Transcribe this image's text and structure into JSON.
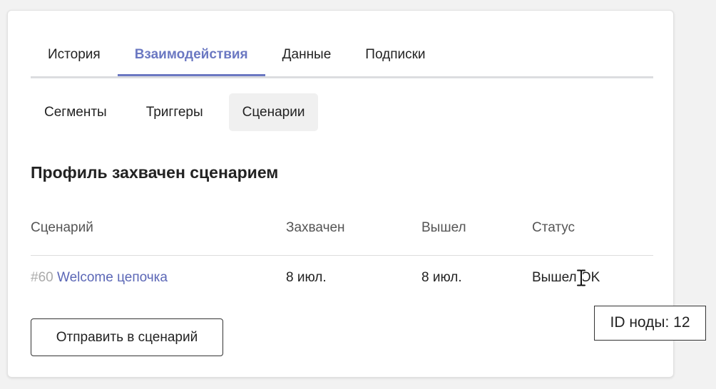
{
  "tabs": [
    {
      "label": "История",
      "active": false
    },
    {
      "label": "Взаимодействия",
      "active": true
    },
    {
      "label": "Данные",
      "active": false
    },
    {
      "label": "Подписки",
      "active": false
    }
  ],
  "subtabs": [
    {
      "label": "Сегменты",
      "active": false
    },
    {
      "label": "Триггеры",
      "active": false
    },
    {
      "label": "Сценарии",
      "active": true
    }
  ],
  "section": {
    "title": "Профиль захвачен сценарием"
  },
  "table": {
    "headers": [
      "Сценарий",
      "Захвачен",
      "Вышел",
      "Статус"
    ],
    "rows": [
      {
        "scenario_id": "#60",
        "scenario_name": "Welcome цепочка",
        "captured": "8 июл.",
        "exited": "8 июл.",
        "status": "Вышел OK"
      }
    ]
  },
  "actions": {
    "send_label": "Отправить в сценарий"
  },
  "tooltip": {
    "text": "ID ноды: 12"
  },
  "colors": {
    "accent": "#6b78c2",
    "link": "#5b67b6",
    "muted_id": "#aaaaaa",
    "tab_underline": "#dcdde0",
    "active_subtab_bg": "#f0f0f0"
  }
}
